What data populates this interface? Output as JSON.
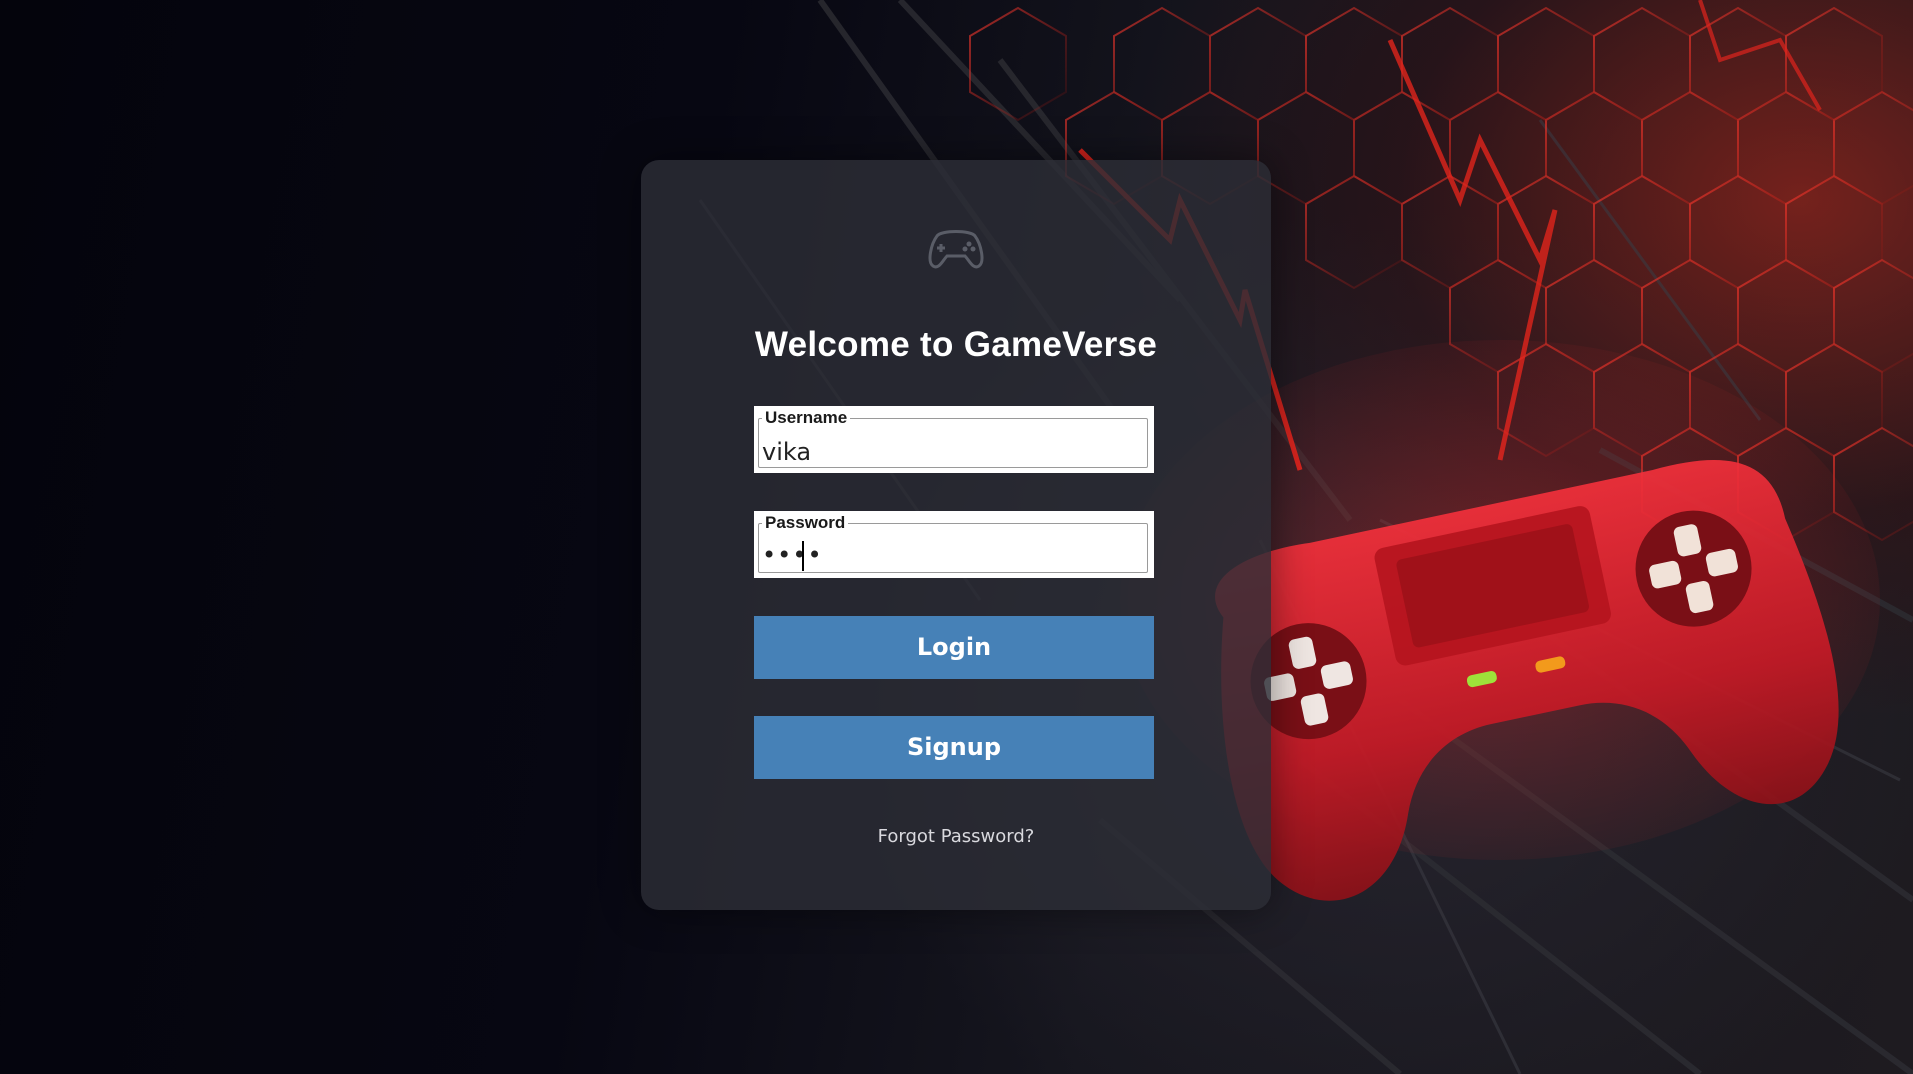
{
  "page": {
    "title": "Welcome to GameVerse"
  },
  "form": {
    "username": {
      "label": "Username",
      "value": "vika"
    },
    "password": {
      "label": "Password",
      "masked_value": "••••"
    },
    "login_label": "Login",
    "signup_label": "Signup",
    "forgot_label": "Forgot Password?"
  },
  "icons": {
    "card_logo": "gamepad-icon",
    "hero": "red-gamepad-illustration"
  },
  "colors": {
    "button": "#4681b7",
    "card": "#2c2d36",
    "accent_red": "#e0241c",
    "background": "#05050d"
  }
}
